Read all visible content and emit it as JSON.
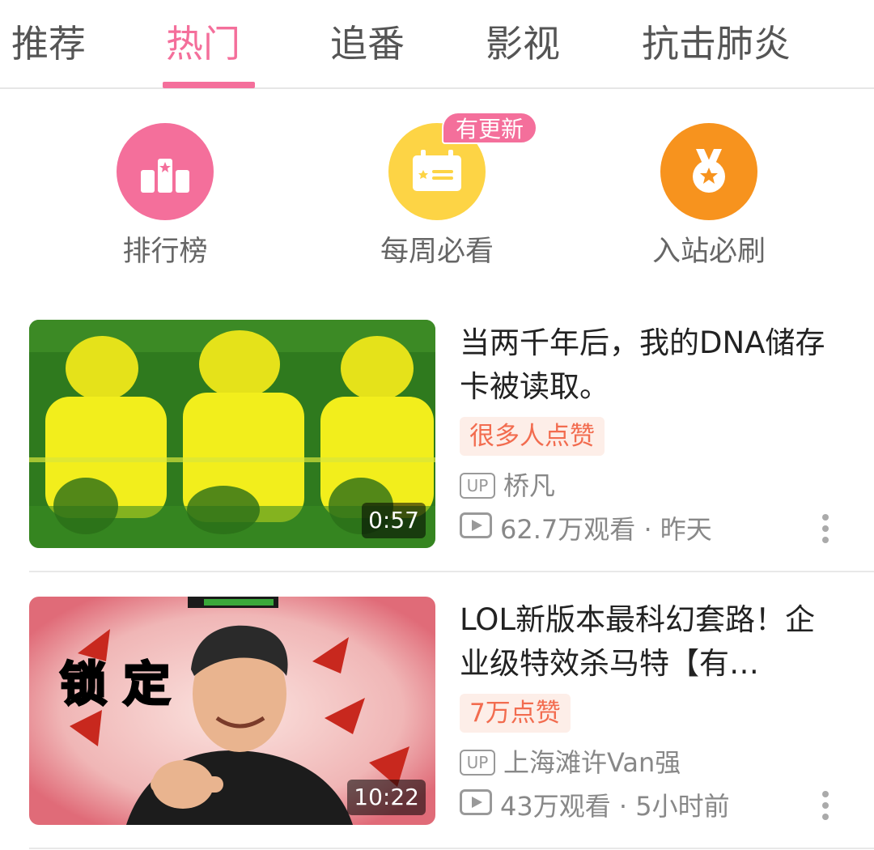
{
  "tabs": [
    {
      "label": "推荐",
      "active": false
    },
    {
      "label": "热门",
      "active": true
    },
    {
      "label": "追番",
      "active": false
    },
    {
      "label": "影视",
      "active": false
    },
    {
      "label": "抗击肺炎",
      "active": false
    }
  ],
  "entries": [
    {
      "label": "排行榜",
      "icon": "ranking-podium-icon",
      "color": "#f46f9b"
    },
    {
      "label": "每周必看",
      "icon": "weekly-calendar-icon",
      "color": "#fdd445"
    },
    {
      "label": "入站必刷",
      "icon": "medal-icon",
      "color": "#f7931e"
    }
  ],
  "weekly_badge": "有更新",
  "videos": [
    {
      "title": "当两千年后，我的DNA储存卡被读取。",
      "tag": "很多人点赞",
      "up_label": "UP",
      "uploader": "桥凡",
      "views": "62.7万观看",
      "separator": "·",
      "time": "昨天",
      "duration": "0:57"
    },
    {
      "title": "LOL新版本最科幻套路！企业级特效杀马特【有…",
      "tag": "7万点赞",
      "up_label": "UP",
      "uploader": "上海滩许Van强",
      "views": "43万观看",
      "separator": "·",
      "time": "5小时前",
      "duration": "10:22",
      "thumb_text": "锁 定"
    }
  ],
  "colors": {
    "accent": "#f46f9b",
    "tag_text": "#f26c4f",
    "tag_bg": "#fdeee8",
    "meta_text": "#888888"
  }
}
